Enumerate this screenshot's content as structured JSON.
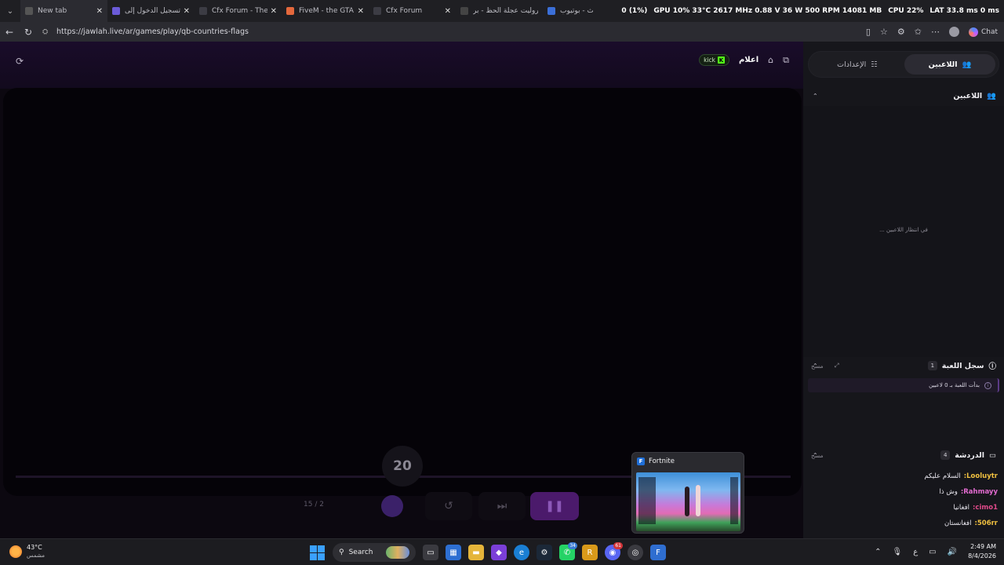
{
  "browser": {
    "tabs": [
      {
        "title": "New tab"
      },
      {
        "title": "تسجيل الدخول إلى xxx"
      },
      {
        "title": "Cfx Forum - The hor"
      },
      {
        "title": "FiveM - the GTA V n"
      },
      {
        "title": "Cfx Forum"
      },
      {
        "title": "روليت عجلة الحظ - بر"
      },
      {
        "title": "بحث - بوتيوب"
      }
    ],
    "hud": {
      "alert": "0 (1%)",
      "gpu": "GPU 10% 33°C 2617 MHz 0.88 V 36 W 500 RPM 14081 MB",
      "cpu": "CPU 22%",
      "lat": "LAT 33.8 ms 0 ms"
    },
    "url": "https://jawlah.live/ar/games/play/qb-countries-flags",
    "chat_button": "Chat"
  },
  "game": {
    "title": "اعلام",
    "kick_label": "kick",
    "timer": "20",
    "counter": "15 / 2",
    "progress_fraction": 0.0
  },
  "side": {
    "tab_players": "اللاعبين",
    "tab_settings": "الإعدادات",
    "players_section": "اللاعبين",
    "waiting_text": "في انتظار اللاعبين ...",
    "log_section": "سجل اللعبة",
    "log_count": "1",
    "log_clear": "مسح",
    "log_entry": "بدأت اللعبة بـ 0 لاعبين",
    "chat_section": "الدردشة",
    "chat_count": "4",
    "chat_clear": "مسح",
    "messages": [
      {
        "user": "Looluytr:",
        "text": "السلام عليكم",
        "color": "#f0c040"
      },
      {
        "user": "Rahmayy:",
        "text": "وش ذا",
        "color": "#e26bd0"
      },
      {
        "user": "cimo1:",
        "text": "افغانيا",
        "color": "#e04a8a"
      },
      {
        "user": "506rr:",
        "text": "افغانستان",
        "color": "#f0c040"
      }
    ]
  },
  "preview": {
    "app_name": "Fortnite"
  },
  "taskbar": {
    "temperature": "43°C",
    "weather_text": "مشمس",
    "search_label": "Search",
    "whatsapp_badge": "34",
    "discord_badge": "61",
    "time": "2:49 AM",
    "date": "8/4/2026",
    "lang": "ع"
  }
}
